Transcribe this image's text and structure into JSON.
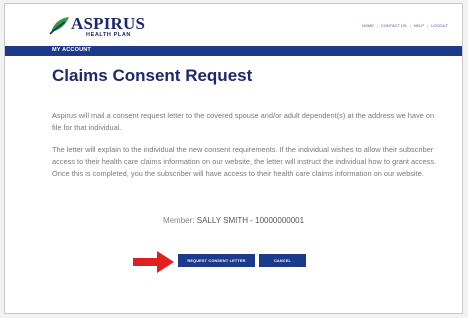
{
  "brand": {
    "name": "ASPIRUS",
    "subtitle": "HEALTH PLAN",
    "accent_color": "#1c3a8c",
    "leaf_color": "#2e9b3e",
    "logo_icon": "leaf-icon"
  },
  "top_links": [
    "HOME",
    "CONTACT US",
    "HELP",
    "LOGOUT"
  ],
  "nav": {
    "my_account": "MY ACCOUNT"
  },
  "page": {
    "title": "Claims Consent Request",
    "paragraph1": "Aspirus will mail a consent request letter to the covered spouse and/or adult dependent(s) at the address we have on file for that individual.",
    "paragraph2": "The letter will explain to the individual the new consent requirements. If the individual wishes to allow their subscriber access to their health care claims information on our website, the letter will instruct the individual how to grant access. Once this is completed, you the subscriber will have access to their health care claims information on our website."
  },
  "member": {
    "label": "Member:",
    "value": "SALLY SMITH - 10000000001"
  },
  "buttons": {
    "request": "REQUEST CONSENT LETTER",
    "cancel": "CANCEL"
  },
  "annotation": {
    "icon": "red-arrow-icon",
    "color": "#e02020"
  }
}
